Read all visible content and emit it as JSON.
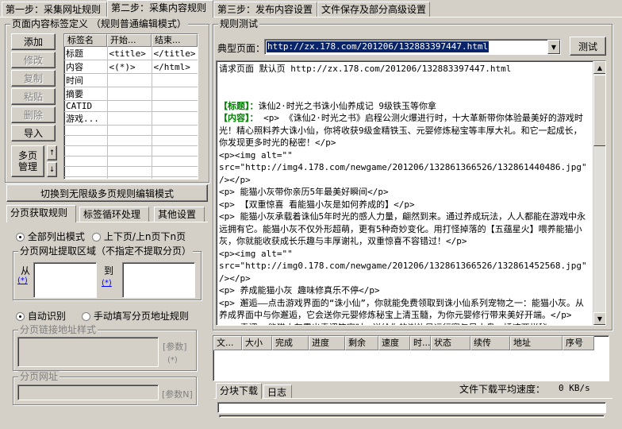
{
  "tabs": {
    "step1": "第一步：采集网址规则",
    "step2": "第二步：采集内容规则",
    "step3": "第三步：发布内容设置",
    "step4": "文件保存及部分高级设置"
  },
  "content_tags": {
    "legend": "页面内容标签定义 （规则普通编辑模式）",
    "buttons": {
      "add": "添加",
      "modify": "修改",
      "copy": "复制",
      "paste": "粘贴",
      "delete": "删除",
      "import": "导入",
      "multipage": "多页\n管理"
    },
    "columns": [
      "标签名",
      "开始...",
      "结束..."
    ],
    "rows": [
      [
        "标题",
        "<title>",
        "</title>"
      ],
      [
        "内容",
        "<(*)>",
        "</html>"
      ],
      [
        "时间",
        "",
        ""
      ],
      [
        "摘要",
        "",
        ""
      ],
      [
        "CATID",
        "",
        ""
      ],
      [
        "游戏...",
        "",
        ""
      ]
    ],
    "switch_button": "切换到无限级多页规则编辑模式"
  },
  "subtabs": {
    "paging": "分页获取规则",
    "loop": "标签循环处理",
    "other": "其他设置"
  },
  "paging": {
    "mode_all": "全部列出模式",
    "mode_updown": "上下页/上n页下n页",
    "region_legend": "分页网址提取区域（不指定不提取分页）",
    "from": "从",
    "to": "到",
    "star": "(*)",
    "auto": "自动识别",
    "manual": "手动填写分页地址规则",
    "link_style_legend": "分页链接地址样式",
    "param": "[参数]",
    "param_star": "(*)",
    "url_legend": "分页网址",
    "paramN": "[参数N]"
  },
  "test": {
    "legend": "规则测试",
    "label": "典型页面：",
    "url": "http://zx.178.com/201206/132883397447.html",
    "test_button": "测试",
    "output": [
      {
        "t": "请求页面 默认页 http://zx.178.com/201206/132883397447.html"
      },
      {
        "t": ""
      },
      {
        "t": ""
      },
      {
        "k": "【标题】：",
        "t": "诛仙2·时光之书诛小仙养成记 9级铁玉等你拿"
      },
      {
        "k": "【内容】：",
        "t": " <p> 《诛仙2·时光之书》启程公测火爆进行时，十大革新带你体验最美好的游戏时光！精心照料养大诛小仙，你将收获9级金精铁玉、元婴修炼秘宝等丰厚大礼。和它一起成长，你发现更多时光的秘密！</p>"
      },
      {
        "t": "<p><img alt=\"\""
      },
      {
        "t": "src=\"http://img4.178.com/newgame/201206/132861366526/132861440486.jpg\" /></p>"
      },
      {
        "t": "<p> 能猫小灰带你亲历5年最美好瞬间</p>"
      },
      {
        "t": "<p> 【双重惊喜 看能猫小灰是如何养成的】</p>"
      },
      {
        "t": "<p> 能猫小灰承载着诛仙5年时光的感人力量，翩然到来。通过养成玩法，人人都能在游戏中永远拥有它。能猫小灰不仅外形超萌，更有5种奇妙变化。用打怪掉落的【五蕴星火】喂养能猫小灰，你就能收获成长乐趣与丰厚谢礼，双重惊喜不容错过！</p>"
      },
      {
        "t": "<p><img alt=\"\""
      },
      {
        "t": "src=\"http://img0.178.com/newgame/201206/132861366526/132861452568.jpg\" /></p>"
      },
      {
        "t": "<p> 养成能猫小灰 趣味修真乐不停</p>"
      },
      {
        "t": "<p> 邂逅——点击游戏界面的“诛小仙”，你就能免费领取到诛小仙系列宠物之一：能猫小灰。从养成界面中与你邂逅，它会送你元婴修炼秘宝上清玉髓，为你元婴修行带来美好开端。</p>"
      },
      {
        "t": "<p> 青涩——能猫小灰露出青涩笑容时，送给你的谢礼是运行赛与风水盘，插迹两样秘"
      }
    ]
  },
  "download": {
    "columns": [
      "文...",
      "大小",
      "完成",
      "进度",
      "剩余",
      "速度",
      "时...",
      "状态",
      "续传",
      "地址",
      "序号"
    ],
    "tab_blocks": "分块下载",
    "tab_log": "日志",
    "avg_speed_label": "文件下载平均速度：",
    "avg_speed": "0 KB/s"
  }
}
